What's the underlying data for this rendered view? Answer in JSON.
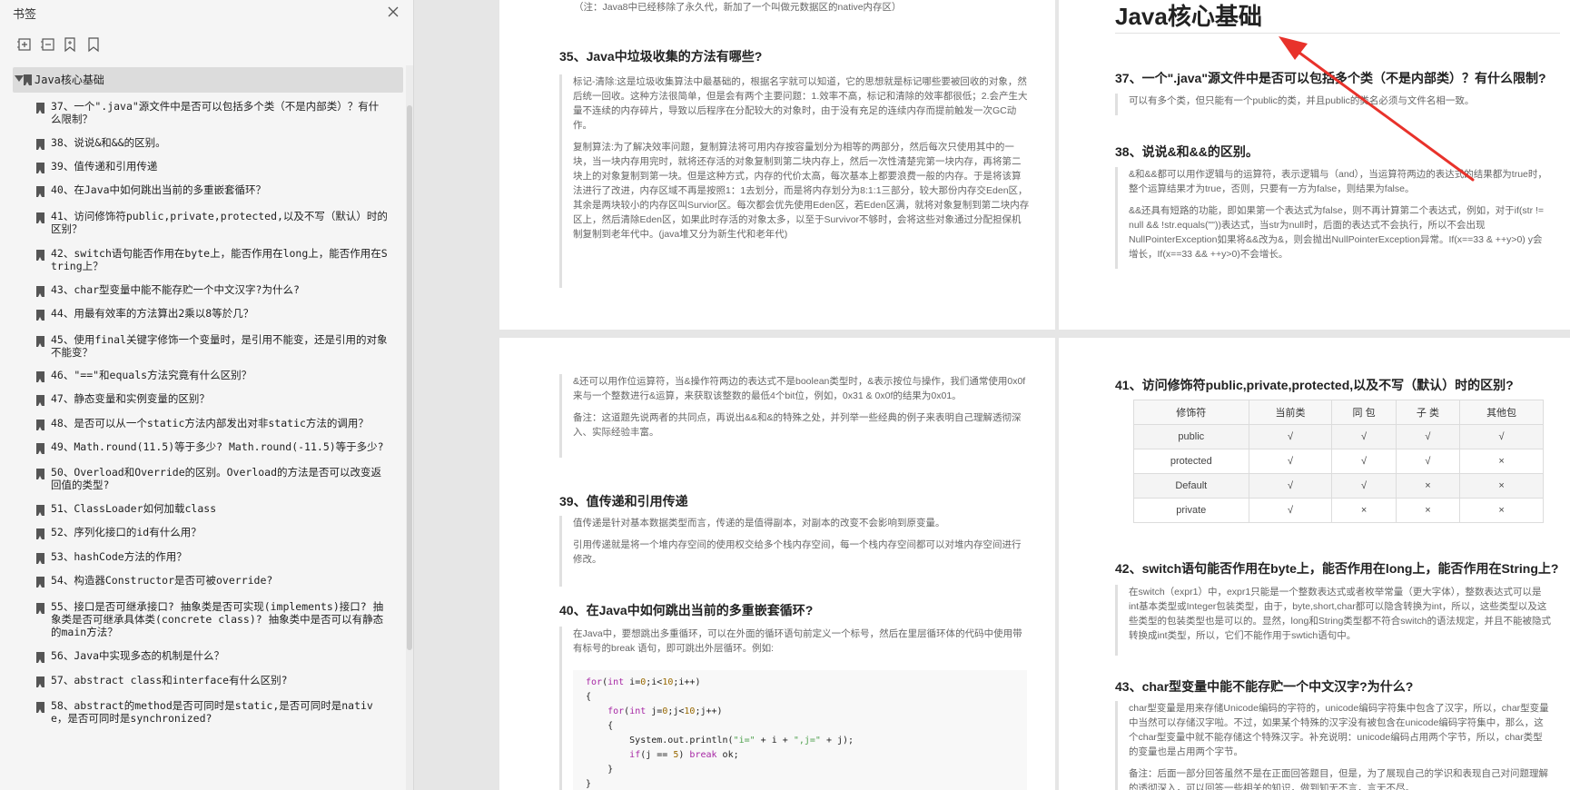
{
  "sidebar": {
    "title": "书签",
    "close_icon": "close-icon",
    "tools": [
      "expand-all-icon",
      "collapse-all-icon",
      "add-bookmark-icon",
      "bookmark-icon"
    ],
    "root": "Java核心基础",
    "items": [
      "37、一个\".java\"源文件中是否可以包括多个类（不是内部类）？有什么限制？",
      "38、说说&和&&的区别。",
      "39、值传递和引用传递",
      "40、在Java中如何跳出当前的多重嵌套循环？",
      "41、访问修饰符public,private,protected,以及不写（默认）时的区别？",
      "42、switch语句能否作用在byte上，能否作用在long上，能否作用在String上？",
      "43、char型变量中能不能存贮一个中文汉字?为什么?",
      "44、用最有效率的方法算出2乘以8等於几？",
      "45、使用final关键字修饰一个变量时，是引用不能变，还是引用的对象不能变？",
      "46、\"==\"和equals方法究竟有什么区别？",
      "47、静态变量和实例变量的区别？",
      "48、是否可以从一个static方法内部发出对非static方法的调用？",
      "49、Math.round(11.5)等于多少? Math.round(-11.5)等于多少?",
      "50、Overload和Override的区别。Overload的方法是否可以改变返回值的类型?",
      "51、ClassLoader如何加载class",
      "52、序列化接口的id有什么用？",
      "53、hashCode方法的作用？",
      "54、构造器Constructor是否可被override?",
      "55、接口是否可继承接口? 抽象类是否可实现(implements)接口? 抽象类是否可继承具体类(concrete class)? 抽象类中是否可以有静态的main方法？",
      "56、Java中实现多态的机制是什么？",
      "57、abstract class和interface有什么区别?",
      "58、abstract的method是否可同时是static,是否可同时是native，是否可同时是synchronized?"
    ]
  },
  "page_a": {
    "top_note": "（注：Java8中已经移除了永久代，新加了一个叫做元数据区的native内存区）",
    "q35_title": "35、Java中垃圾收集的方法有哪些?",
    "q35_p1": "标记-清除:这是垃圾收集算法中最基础的，根据名字就可以知道，它的思想就是标记哪些要被回收的对象，然后统一回收。这种方法很简单，但是会有两个主要问题：1.效率不高，标记和清除的效率都很低；2.会产生大量不连续的内存碎片，导致以后程序在分配较大的对象时，由于没有充足的连续内存而提前触发一次GC动作。",
    "q35_p2": "复制算法:为了解决效率问题，复制算法将可用内存按容量划分为相等的两部分，然后每次只使用其中的一块，当一块内存用完时，就将还存活的对象复制到第二块内存上，然后一次性清楚完第一块内存，再将第二块上的对象复制到第一块。但是这种方式，内存的代价太高，每次基本上都要浪费一般的内存。于是将该算法进行了改进，内存区域不再是按照1：1去划分，而是将内存划分为8:1:1三部分，较大那份内存交Eden区，其余是两块较小的内存区叫Survior区。每次都会优先使用Eden区，若Eden区满，就将对象复制到第二块内存区上，然后清除Eden区，如果此时存活的对象太多，以至于Survivor不够时，会将这些对象通过分配担保机制复制到老年代中。(java堆又分为新生代和老年代)"
  },
  "page_b": {
    "heading": "Java核心基础",
    "q37_title": "37、一个\".java\"源文件中是否可以包括多个类（不是内部类）？有什么限制?",
    "q37_p1": "可以有多个类，但只能有一个public的类，并且public的类名必须与文件名相一致。",
    "q38_title": "38、说说&和&&的区别。",
    "q38_p1": "&和&&都可以用作逻辑与的运算符，表示逻辑与（and），当运算符两边的表达式的结果都为true时，整个运算结果才为true，否则，只要有一方为false，则结果为false。",
    "q38_p2": "&&还具有短路的功能，即如果第一个表达式为false，则不再计算第二个表达式，例如，对于if(str != null && !str.equals(\"\"))表达式，当str为null时，后面的表达式不会执行，所以不会出现NullPointerException如果将&&改为&，则会抛出NullPointerException异常。If(x==33 & ++y>0) y会增长，If(x==33 && ++y>0)不会增长。"
  },
  "page_c": {
    "p1": "&还可以用作位运算符，当&操作符两边的表达式不是boolean类型时，&表示按位与操作，我们通常使用0x0f来与一个整数进行&运算，来获取该整数的最低4个bit位，例如，0x31 & 0x0f的结果为0x01。",
    "p2": "备注：这道题先说两者的共同点，再说出&&和&的特殊之处，并列举一些经典的例子来表明自己理解透彻深入、实际经验丰富。",
    "q39_title": "39、值传递和引用传递",
    "q39_p1": "值传递是针对基本数据类型而言，传递的是值得副本，对副本的改变不会影响到原变量。",
    "q39_p2": "引用传递就是将一个堆内存空间的使用权交给多个栈内存空间，每一个栈内存空间都可以对堆内存空间进行修改。",
    "q40_title": "40、在Java中如何跳出当前的多重嵌套循环?",
    "q40_p1": "在Java中，要想跳出多重循环，可以在外面的循环语句前定义一个标号，然后在里层循环体的代码中使用带有标号的break 语句，即可跳出外层循环。例如:",
    "code": [
      {
        "indent": 0,
        "text": "for(int i=0;i<10;i++)"
      },
      {
        "indent": 0,
        "text": "{"
      },
      {
        "indent": 1,
        "text": "for(int j=0;j<10;j++)"
      },
      {
        "indent": 1,
        "text": "{"
      },
      {
        "indent": 2,
        "text": "System.out.println(\"i=\" + i + \",j=\" + j);"
      },
      {
        "indent": 2,
        "text": "if(j == 5) break ok;"
      },
      {
        "indent": 1,
        "text": "}"
      },
      {
        "indent": 0,
        "text": "}"
      }
    ]
  },
  "page_d": {
    "q41_title": "41、访问修饰符public,private,protected,以及不写（默认）时的区别?",
    "table": {
      "headers": [
        "修饰符",
        "当前类",
        "同 包",
        "子 类",
        "其他包"
      ],
      "rows": [
        [
          "public",
          "√",
          "√",
          "√",
          "√"
        ],
        [
          "protected",
          "√",
          "√",
          "√",
          "×"
        ],
        [
          "Default",
          "√",
          "√",
          "×",
          "×"
        ],
        [
          "private",
          "√",
          "×",
          "×",
          "×"
        ]
      ]
    },
    "q42_title": "42、switch语句能否作用在byte上，能否作用在long上，能否作用在String上?",
    "q42_p1": "在switch（expr1）中，expr1只能是一个整数表达式或者枚举常量（更大字体），整数表达式可以是int基本类型或Integer包装类型，由于，byte,short,char都可以隐含转换为int，所以，这些类型以及这些类型的包装类型也是可以的。显然，long和String类型都不符合switch的语法规定，并且不能被隐式转换成int类型，所以，它们不能作用于swtich语句中。",
    "q43_title": "43、char型变量中能不能存贮一个中文汉字?为什么?",
    "q43_p1": "char型变量是用来存储Unicode编码的字符的，unicode编码字符集中包含了汉字，所以，char型变量中当然可以存储汉字啦。不过，如果某个特殊的汉字没有被包含在unicode编码字符集中，那么，这个char型变量中就不能存储这个特殊汉字。补充说明：unicode编码占用两个字节，所以，char类型的变量也是占用两个字节。",
    "q43_p2": "备注：后面一部分回答虽然不是在正面回答题目，但是，为了展现自己的学识和表现自己对问题理解的透彻深入，可以回答一些相关的知识，做到知无不言，言无不尽。"
  },
  "annotation": {
    "arrow_color": "#e8322b",
    "icon": "red-arrow-annotation"
  }
}
